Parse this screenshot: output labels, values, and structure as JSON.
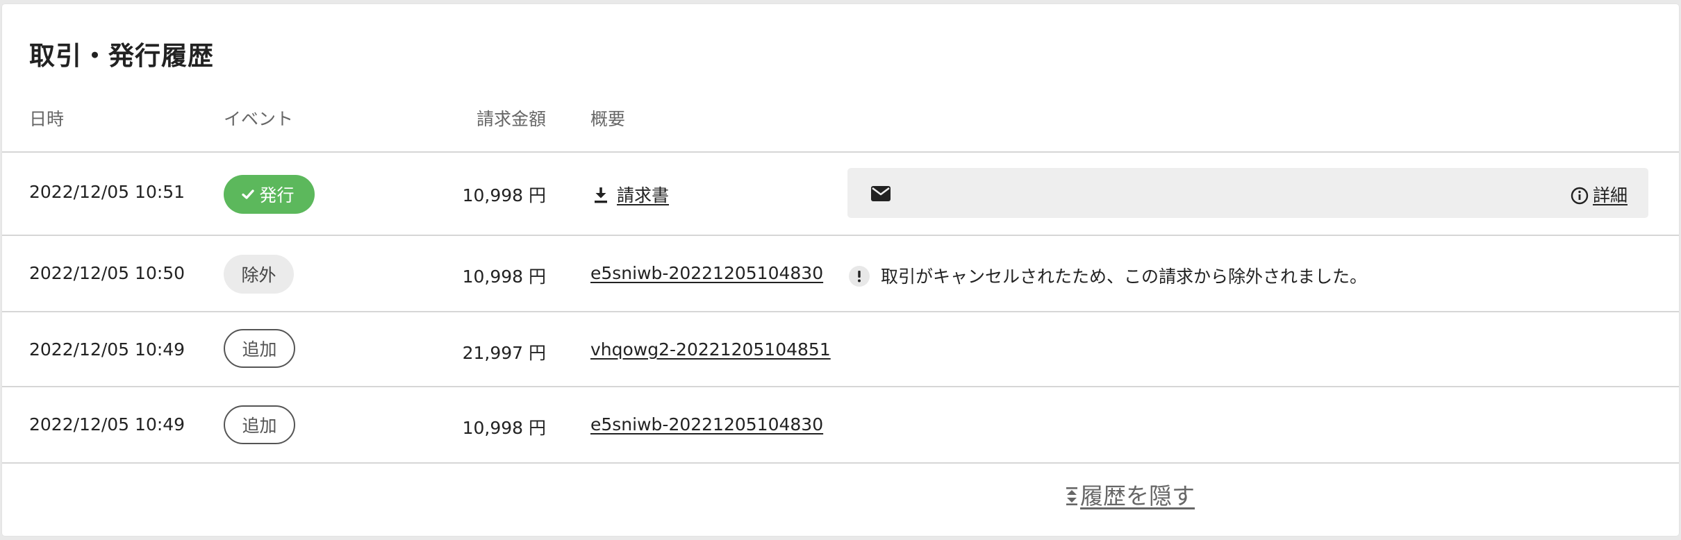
{
  "title": "取引・発行履歴",
  "columns": {
    "date": "日時",
    "event": "イベント",
    "amount": "請求金額",
    "summary": "概要"
  },
  "rows": [
    {
      "date": "2022/12/05 10:51",
      "event": "発行",
      "amount": "10,998 円",
      "summary_link": "請求書",
      "detail_label": "詳細"
    },
    {
      "date": "2022/12/05 10:50",
      "event": "除外",
      "amount": "10,998 円",
      "summary_link": "e5sniwb-20221205104830",
      "note": "取引がキャンセルされたため、この請求から除外されました。"
    },
    {
      "date": "2022/12/05 10:49",
      "event": "追加",
      "amount": "21,997 円",
      "summary_link": "vhqowg2-20221205104851"
    },
    {
      "date": "2022/12/05 10:49",
      "event": "追加",
      "amount": "10,998 円",
      "summary_link": "e5sniwb-20221205104830"
    }
  ],
  "footer": {
    "hide_history": "履歴を隠す"
  },
  "colors": {
    "issued_badge": "#5cb85c",
    "excluded_badge": "#ebebeb",
    "notice_background": "#eeeeee",
    "divider": "#d6d6d6"
  },
  "icons": {
    "issued": "check-icon",
    "download": "download-icon",
    "mail": "envelope-icon",
    "info": "info-icon",
    "warning": "exclamation-icon",
    "collapse": "collapse-icon"
  }
}
